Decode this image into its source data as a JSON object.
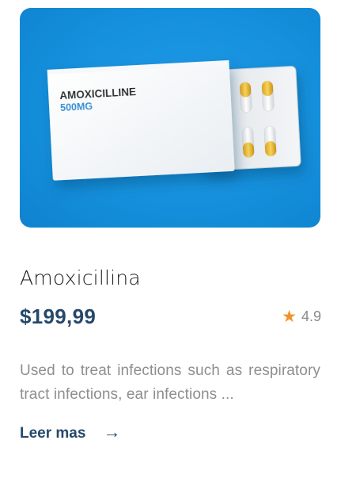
{
  "card": {
    "image": {
      "box_brand": "AMOXICILLINE",
      "box_dose": "500MG",
      "background_color": "#1590dc",
      "dose_color": "#2f8fd8"
    },
    "name": "Amoxicillina",
    "price": "$199,99",
    "rating": {
      "icon": "star-icon",
      "value": "4.9",
      "star_color": "#f0932b"
    },
    "description": "Used to treat infections such as respiratory tract infections, ear infections ...",
    "read_more": {
      "label": "Leer mas",
      "icon": "arrow-right-icon",
      "glyph": "→"
    },
    "accent_color": "#26486b"
  }
}
